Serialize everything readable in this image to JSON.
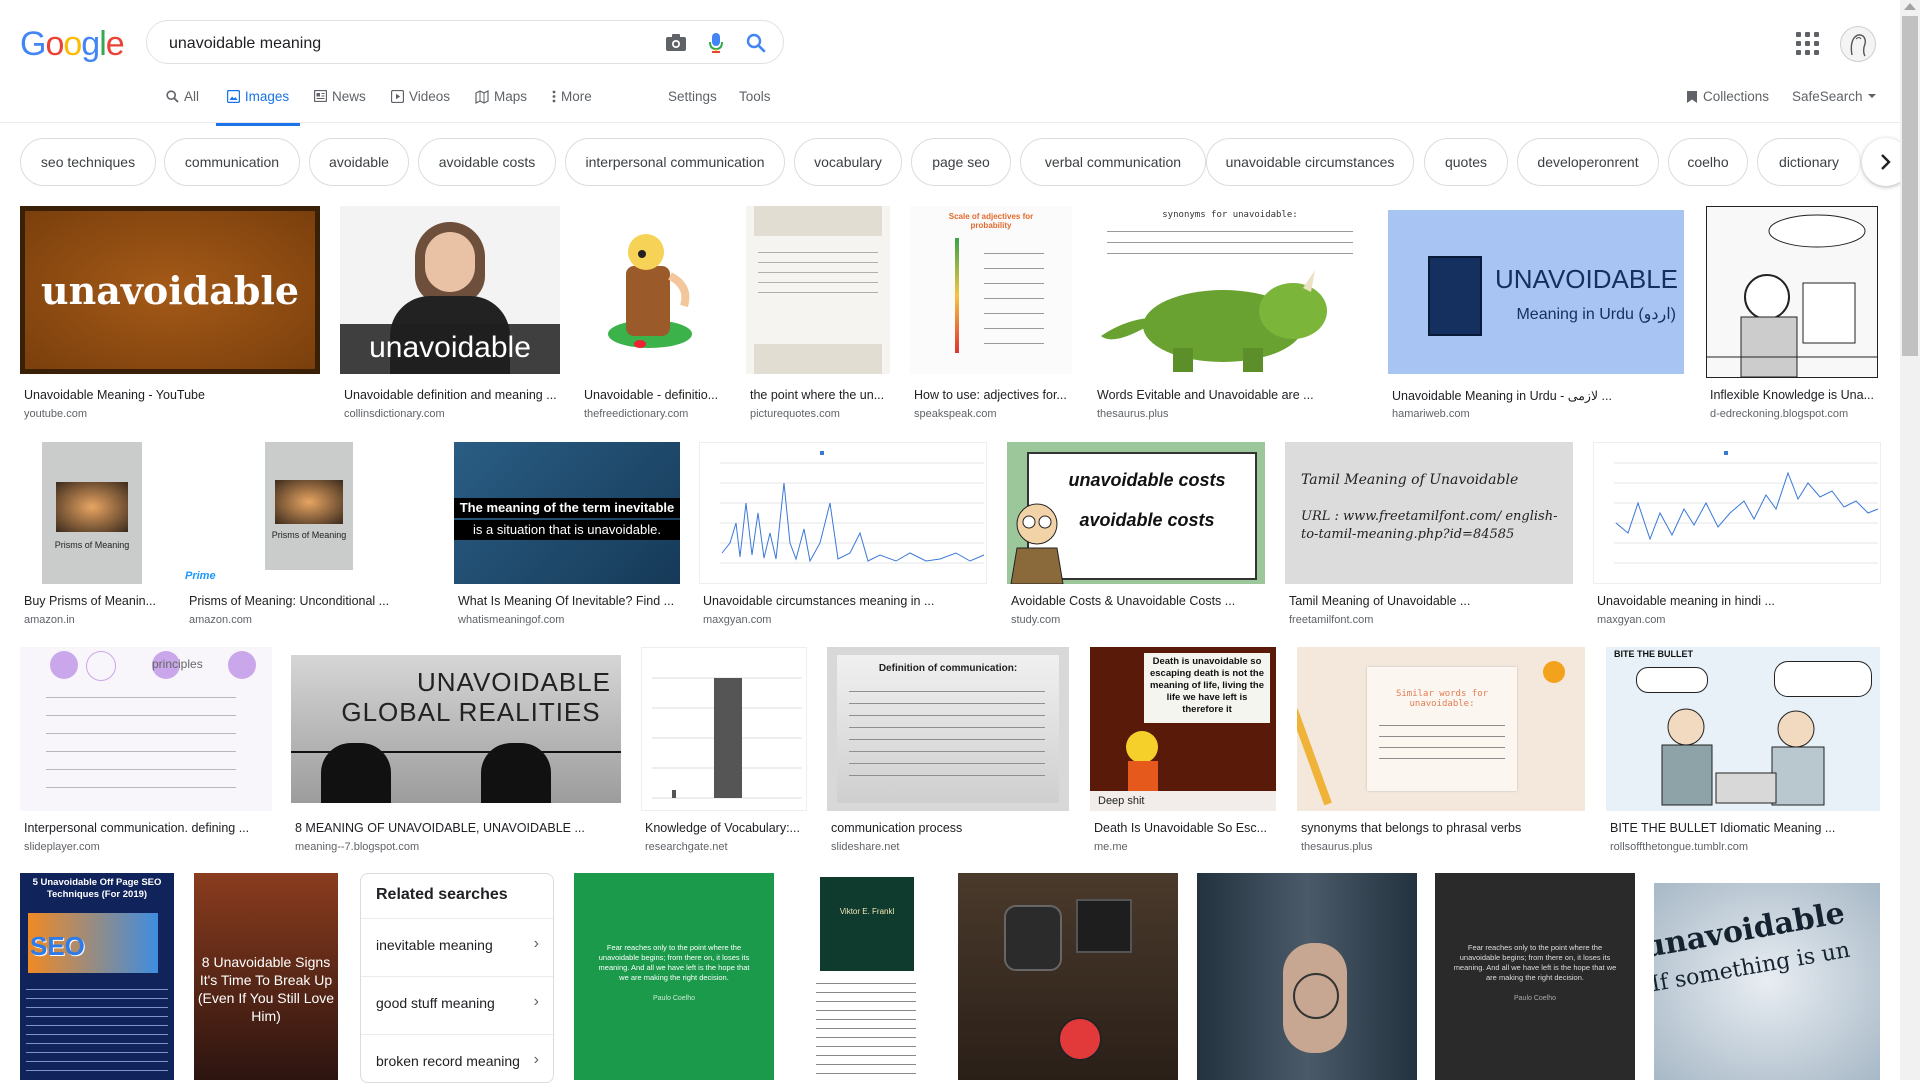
{
  "logo": {
    "G": "G",
    "o1": "o",
    "o2": "o",
    "g": "g",
    "l": "l",
    "e": "e"
  },
  "search": {
    "query": "unavoidable meaning"
  },
  "nav": {
    "tabs": [
      "All",
      "Images",
      "News",
      "Videos",
      "Maps",
      "More"
    ],
    "settings": "Settings",
    "tools": "Tools",
    "collections": "Collections",
    "safesearch": "SafeSearch"
  },
  "chips": [
    "seo techniques",
    "communication",
    "avoidable",
    "avoidable costs",
    "interpersonal communication",
    "vocabulary",
    "page seo",
    "verbal communication",
    "unavoidable circumstances",
    "quotes",
    "developeronrent",
    "coelho",
    "dictionary"
  ],
  "results": [
    {
      "title": "Unavoidable Meaning - YouTube",
      "site": "youtube.com",
      "thumb_text": "unavoidable"
    },
    {
      "title": "Unavoidable definition and meaning ...",
      "site": "collinsdictionary.com",
      "thumb_text": "unavoidable"
    },
    {
      "title": "Unavoidable - definitio...",
      "site": "thefreedictionary.com"
    },
    {
      "title": "the point where the un...",
      "site": "picturequotes.com"
    },
    {
      "title": "How to use: adjectives for...",
      "site": "speakspeak.com",
      "thumb_text": "Scale of adjectives for probability"
    },
    {
      "title": "Words Evitable and Unavoidable are ...",
      "site": "thesaurus.plus",
      "thumb_text": "synonyms for unavoidable:"
    },
    {
      "title": "Unavoidable Meaning in Urdu - لازمی ...",
      "site": "hamariweb.com",
      "thumb_text": "UNAVOIDABLE",
      "thumb_sub": "Meaning in Urdu (اردو)"
    },
    {
      "title": "Inflexible Knowledge is Una...",
      "site": "d-edreckoning.blogspot.com"
    },
    {
      "title": "Buy Prisms of Meanin...",
      "site": "amazon.in",
      "thumb_text": "Prisms of Meaning"
    },
    {
      "title": "Prisms of Meaning: Unconditional ...",
      "site": "amazon.com",
      "thumb_text": "Prisms of Meaning",
      "thumb_sub": "Prime"
    },
    {
      "title": "What Is Meaning Of Inevitable? Find ...",
      "site": "whatismeaningof.com",
      "thumb_text": "The meaning of the term inevitable",
      "thumb_sub": "is a situation that is unavoidable."
    },
    {
      "title": "Unavoidable circumstances meaning in ...",
      "site": "maxgyan.com"
    },
    {
      "title": "Avoidable Costs & Unavoidable Costs ...",
      "site": "study.com",
      "thumb_text": "unavoidable costs",
      "thumb_sub": "avoidable costs"
    },
    {
      "title": "Tamil Meaning of Unavoidable ...",
      "site": "freetamilfont.com",
      "thumb_text": "Tamil Meaning of Unavoidable",
      "thumb_sub": "URL : www.freetamilfont.com/ english-to-tamil-meaning.php?id=84585"
    },
    {
      "title": "Unavoidable meaning in hindi ...",
      "site": "maxgyan.com"
    },
    {
      "title": "Interpersonal communication. defining ...",
      "site": "slideplayer.com",
      "thumb_text": "principles"
    },
    {
      "title": "8 MEANING OF UNAVOIDABLE, UNAVOIDABLE ...",
      "site": "meaning--7.blogspot.com",
      "thumb_text": "UNAVOIDABLE",
      "thumb_sub": "GLOBAL REALITIES"
    },
    {
      "title": "Knowledge of Vocabulary:...",
      "site": "researchgate.net"
    },
    {
      "title": "communication process",
      "site": "slideshare.net",
      "thumb_text": "Definition of communication:"
    },
    {
      "title": "Death Is Unavoidable So Esc...",
      "site": "me.me",
      "thumb_text": "Death is unavoidable so escaping death is not the meaning of life, living the life we have left is therefore it",
      "thumb_sub": "Deep shit"
    },
    {
      "title": "synonyms that belongs to phrasal verbs",
      "site": "thesaurus.plus",
      "thumb_text": "Similar words for unavoidable:"
    },
    {
      "title": "BITE THE BULLET Idiomatic Meaning ...",
      "site": "rollsoffthetongue.tumblr.com",
      "thumb_text": "BITE THE BULLET"
    },
    {
      "thumb_text": "5 Unavoidable Off Page SEO Techniques (For 2019)",
      "thumb_sub": "SEO"
    },
    {
      "thumb_text": "8 Unavoidable Signs It's Time To Break Up (Even If You Still Love Him)"
    },
    {
      "thumb_text": "Fear reaches only to the point where the unavoidable begins; from there on, it loses its meaning. And all we have left is the hope that we are making the right decision.",
      "thumb_sub": "Paulo Coelho"
    },
    {
      "thumb_text": "Viktor E. Frankl"
    },
    {
      "thumb_text": "unavoidable",
      "thumb_sub": "If something is un"
    }
  ],
  "related": {
    "title": "Related searches",
    "items": [
      "inevitable meaning",
      "good stuff meaning",
      "broken record meaning"
    ]
  }
}
